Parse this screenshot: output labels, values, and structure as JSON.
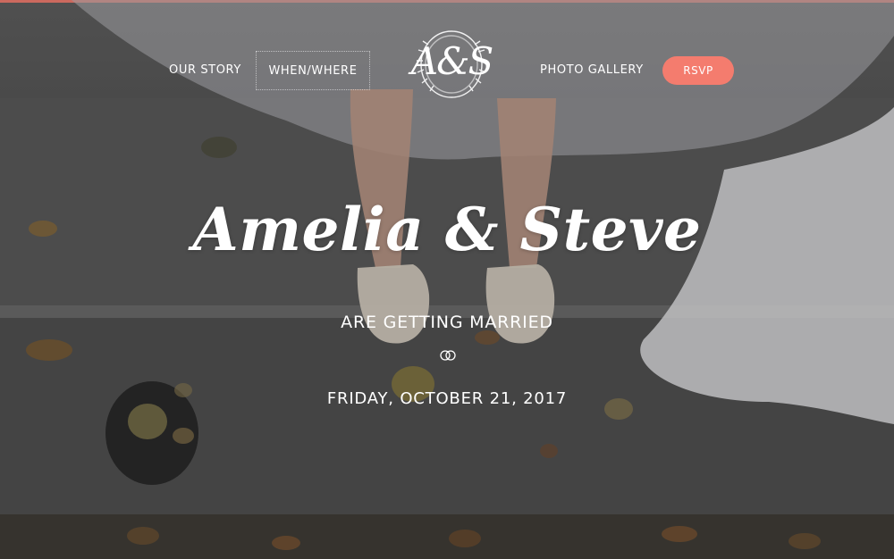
{
  "nav": {
    "our_story": "OUR STORY",
    "when_where": "WHEN/WHERE",
    "photo_gallery": "PHOTO GALLERY",
    "rsvp": "RSVP"
  },
  "logo": {
    "text": "A&S"
  },
  "hero": {
    "couple": "Amelia & Steve",
    "subtitle": "ARE GETTING MARRIED",
    "date": "FRIDAY, OCTOBER 21, 2017"
  },
  "colors": {
    "accent": "#f47c6e",
    "text": "#ffffff"
  },
  "icons": {
    "logo_wreath": "wreath-icon",
    "rings": "wedding-rings-icon"
  }
}
